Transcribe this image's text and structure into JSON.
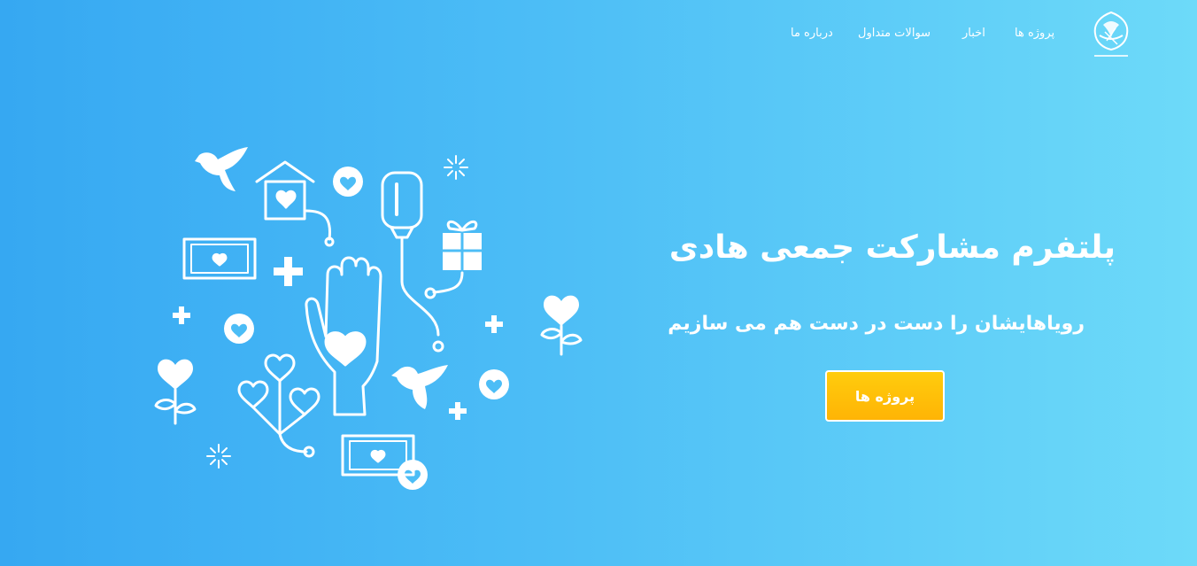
{
  "colors": {
    "bg_start": "#36a8f2",
    "bg_end": "#6ddaf9",
    "accent": "#ffbf08",
    "text": "#ffffff"
  },
  "nav": {
    "items": [
      {
        "label": "پروژه ها"
      },
      {
        "label": "اخبار"
      },
      {
        "label": "سوالات متداول"
      },
      {
        "label": "درباره ما"
      }
    ]
  },
  "hero": {
    "title": "پلتفرم مشارکت جمعی هادی",
    "subtitle": "رویاهایشان را دست در دست هم می سازیم",
    "cta_label": "پروژه ها"
  },
  "icons": {
    "logo": "calligraphy-logo-icon",
    "illustration": "charity-hand-heart-illustration"
  }
}
